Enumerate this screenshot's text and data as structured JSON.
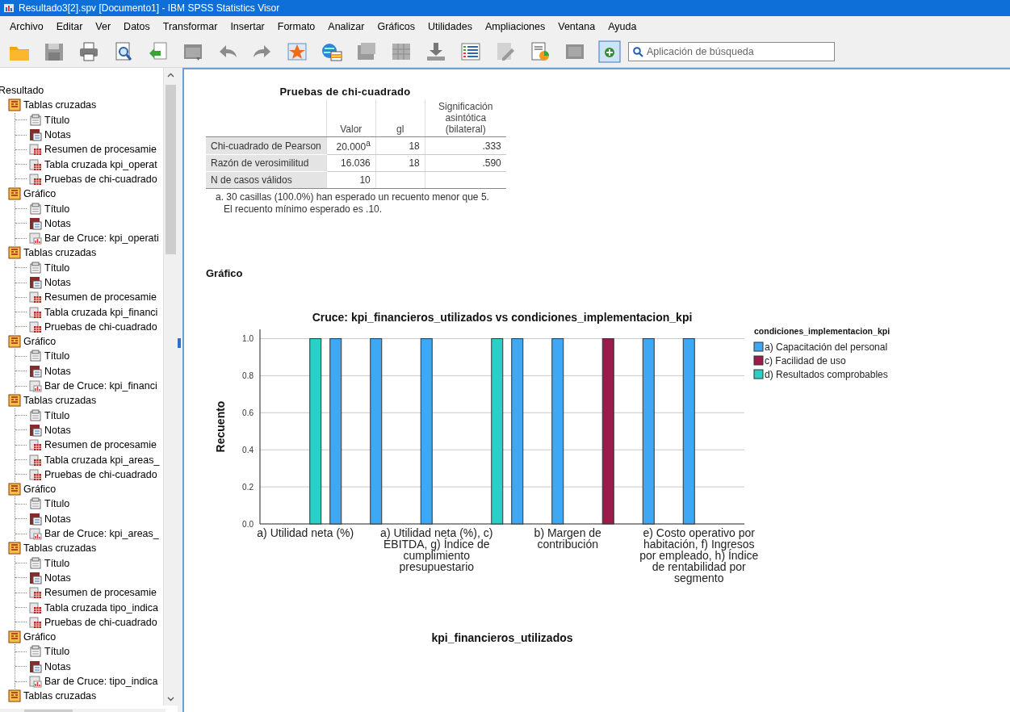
{
  "window": {
    "title": "Resultado3[2].spv [Documento1] - IBM SPSS Statistics Visor"
  },
  "menu": [
    "Archivo",
    "Editar",
    "Ver",
    "Datos",
    "Transformar",
    "Insertar",
    "Formato",
    "Analizar",
    "Gráficos",
    "Utilidades",
    "Ampliaciones",
    "Ventana",
    "Ayuda"
  ],
  "search": {
    "placeholder": "Aplicación de búsqueda"
  },
  "outline": {
    "root": "Resultado",
    "items": [
      {
        "label": "Tablas cruzadas",
        "kind": "group",
        "children": [
          {
            "label": "Título",
            "kind": "title"
          },
          {
            "label": "Notas",
            "kind": "notes"
          },
          {
            "label": "Resumen de procesamie",
            "kind": "table"
          },
          {
            "label": "Tabla cruzada kpi_operat",
            "kind": "table"
          },
          {
            "label": "Pruebas de chi-cuadrado",
            "kind": "table"
          }
        ]
      },
      {
        "label": "Gráfico",
        "kind": "group",
        "children": [
          {
            "label": "Título",
            "kind": "title"
          },
          {
            "label": "Notas",
            "kind": "notes"
          },
          {
            "label": "Bar de Cruce: kpi_operati",
            "kind": "chart"
          }
        ]
      },
      {
        "label": "Tablas cruzadas",
        "kind": "group",
        "children": [
          {
            "label": "Título",
            "kind": "title"
          },
          {
            "label": "Notas",
            "kind": "notes"
          },
          {
            "label": "Resumen de procesamie",
            "kind": "table"
          },
          {
            "label": "Tabla cruzada kpi_financi",
            "kind": "table"
          },
          {
            "label": "Pruebas de chi-cuadrado",
            "kind": "table"
          }
        ]
      },
      {
        "label": "Gráfico",
        "kind": "group",
        "children": [
          {
            "label": "Título",
            "kind": "title"
          },
          {
            "label": "Notas",
            "kind": "notes"
          },
          {
            "label": "Bar de Cruce: kpi_financi",
            "kind": "chart"
          }
        ]
      },
      {
        "label": "Tablas cruzadas",
        "kind": "group",
        "children": [
          {
            "label": "Título",
            "kind": "title"
          },
          {
            "label": "Notas",
            "kind": "notes"
          },
          {
            "label": "Resumen de procesamie",
            "kind": "table"
          },
          {
            "label": "Tabla cruzada kpi_areas_",
            "kind": "table"
          },
          {
            "label": "Pruebas de chi-cuadrado",
            "kind": "table"
          }
        ]
      },
      {
        "label": "Gráfico",
        "kind": "group",
        "children": [
          {
            "label": "Título",
            "kind": "title"
          },
          {
            "label": "Notas",
            "kind": "notes"
          },
          {
            "label": "Bar de Cruce: kpi_areas_",
            "kind": "chart"
          }
        ]
      },
      {
        "label": "Tablas cruzadas",
        "kind": "group",
        "children": [
          {
            "label": "Título",
            "kind": "title"
          },
          {
            "label": "Notas",
            "kind": "notes"
          },
          {
            "label": "Resumen de procesamie",
            "kind": "table"
          },
          {
            "label": "Tabla cruzada tipo_indica",
            "kind": "table"
          },
          {
            "label": "Pruebas de chi-cuadrado",
            "kind": "table"
          }
        ]
      },
      {
        "label": "Gráfico",
        "kind": "group",
        "children": [
          {
            "label": "Título",
            "kind": "title"
          },
          {
            "label": "Notas",
            "kind": "notes"
          },
          {
            "label": "Bar de Cruce: tipo_indica",
            "kind": "chart"
          }
        ]
      },
      {
        "label": "Tablas cruzadas",
        "kind": "group"
      }
    ]
  },
  "table": {
    "title": "Pruebas de chi-cuadrado",
    "columns": [
      "Valor",
      "gl",
      "Significación asintótica (bilateral)"
    ],
    "rows": [
      {
        "label": "Chi-cuadrado de Pearson",
        "cells": [
          "20.000$^{a}$",
          "18",
          ".333"
        ]
      },
      {
        "label": "Razón de verosimilitud",
        "cells": [
          "16.036",
          "18",
          ".590"
        ]
      },
      {
        "label": "N de casos válidos",
        "cells": [
          "10"
        ]
      }
    ],
    "footnote": "a. 30 casillas (100.0%) han esperado un recuento menor que 5. El recuento mínimo esperado es .10."
  },
  "chart_heading": "Gráfico",
  "chart": {
    "legend_title": "condiciones_implementacion_kpi",
    "chart_data": {
      "type": "bar",
      "title": "Cruce: kpi_financieros_utilizados vs condiciones_implementacion_kpi",
      "xlabel": "kpi_financieros_utilizados",
      "ylabel": "Recuento",
      "categories": [
        null,
        null,
        null,
        null,
        "a) Utilidad neta (%)",
        null,
        null,
        null,
        null,
        null,
        null,
        null,
        null,
        null,
        null,
        null,
        null,
        "a) Utilidad neta (%), c) EBITDA, g) Índice de cumplimiento presupuestario",
        null,
        null,
        null,
        null,
        null,
        null,
        null,
        null,
        null,
        null,
        null,
        null,
        "b) Margen de contribución",
        null,
        null,
        null,
        null,
        null,
        null,
        null,
        null,
        null,
        null,
        null,
        null,
        "e) Costo operativo por habitación, f) Ingresos por empleado, h) Índice de rentabilidad por segmento",
        null,
        null,
        null,
        null
      ],
      "series": [
        {
          "name": "a) Capacitación del personal",
          "color": "#3ea8f5",
          "values": [
            null,
            null,
            null,
            null,
            null,
            null,
            null,
            1,
            null,
            null,
            null,
            1,
            null,
            null,
            null,
            null,
            1,
            null,
            null,
            null,
            null,
            null,
            null,
            null,
            null,
            1,
            null,
            null,
            null,
            1,
            null,
            null,
            null,
            null,
            null,
            null,
            null,
            null,
            1,
            null,
            null,
            null,
            1,
            null,
            null,
            null,
            null,
            null
          ]
        },
        {
          "name": "c) Facilidad de uso",
          "color": "#9b1b4a",
          "values": [
            null,
            null,
            null,
            null,
            null,
            null,
            null,
            null,
            null,
            null,
            null,
            null,
            null,
            null,
            null,
            null,
            null,
            null,
            null,
            null,
            null,
            null,
            null,
            null,
            null,
            null,
            null,
            null,
            null,
            null,
            null,
            null,
            null,
            null,
            1,
            null,
            null,
            null,
            null,
            null,
            null,
            null,
            null,
            null,
            null,
            null,
            null,
            null
          ]
        },
        {
          "name": "d) Resultados comprobables",
          "color": "#29d0c8",
          "values": [
            null,
            null,
            null,
            null,
            null,
            1,
            null,
            null,
            null,
            null,
            null,
            null,
            null,
            null,
            null,
            null,
            null,
            null,
            null,
            null,
            null,
            null,
            null,
            1,
            null,
            null,
            null,
            null,
            null,
            null,
            null,
            null,
            null,
            null,
            null,
            null,
            null,
            null,
            null,
            null,
            null,
            null,
            null,
            null,
            null,
            null,
            null,
            null
          ]
        }
      ],
      "ylim": [
        0,
        1.05
      ],
      "grid": true,
      "legend": "right",
      "yticks": [
        {
          "value": 0,
          "label": "0.0"
        },
        {
          "value": 0.2,
          "label": "0.2"
        },
        {
          "value": 0.4,
          "label": "0.4"
        },
        {
          "value": 0.6,
          "label": "0.6"
        },
        {
          "value": 0.8,
          "label": "0.8"
        },
        {
          "value": 1,
          "label": "1.0"
        }
      ]
    }
  }
}
